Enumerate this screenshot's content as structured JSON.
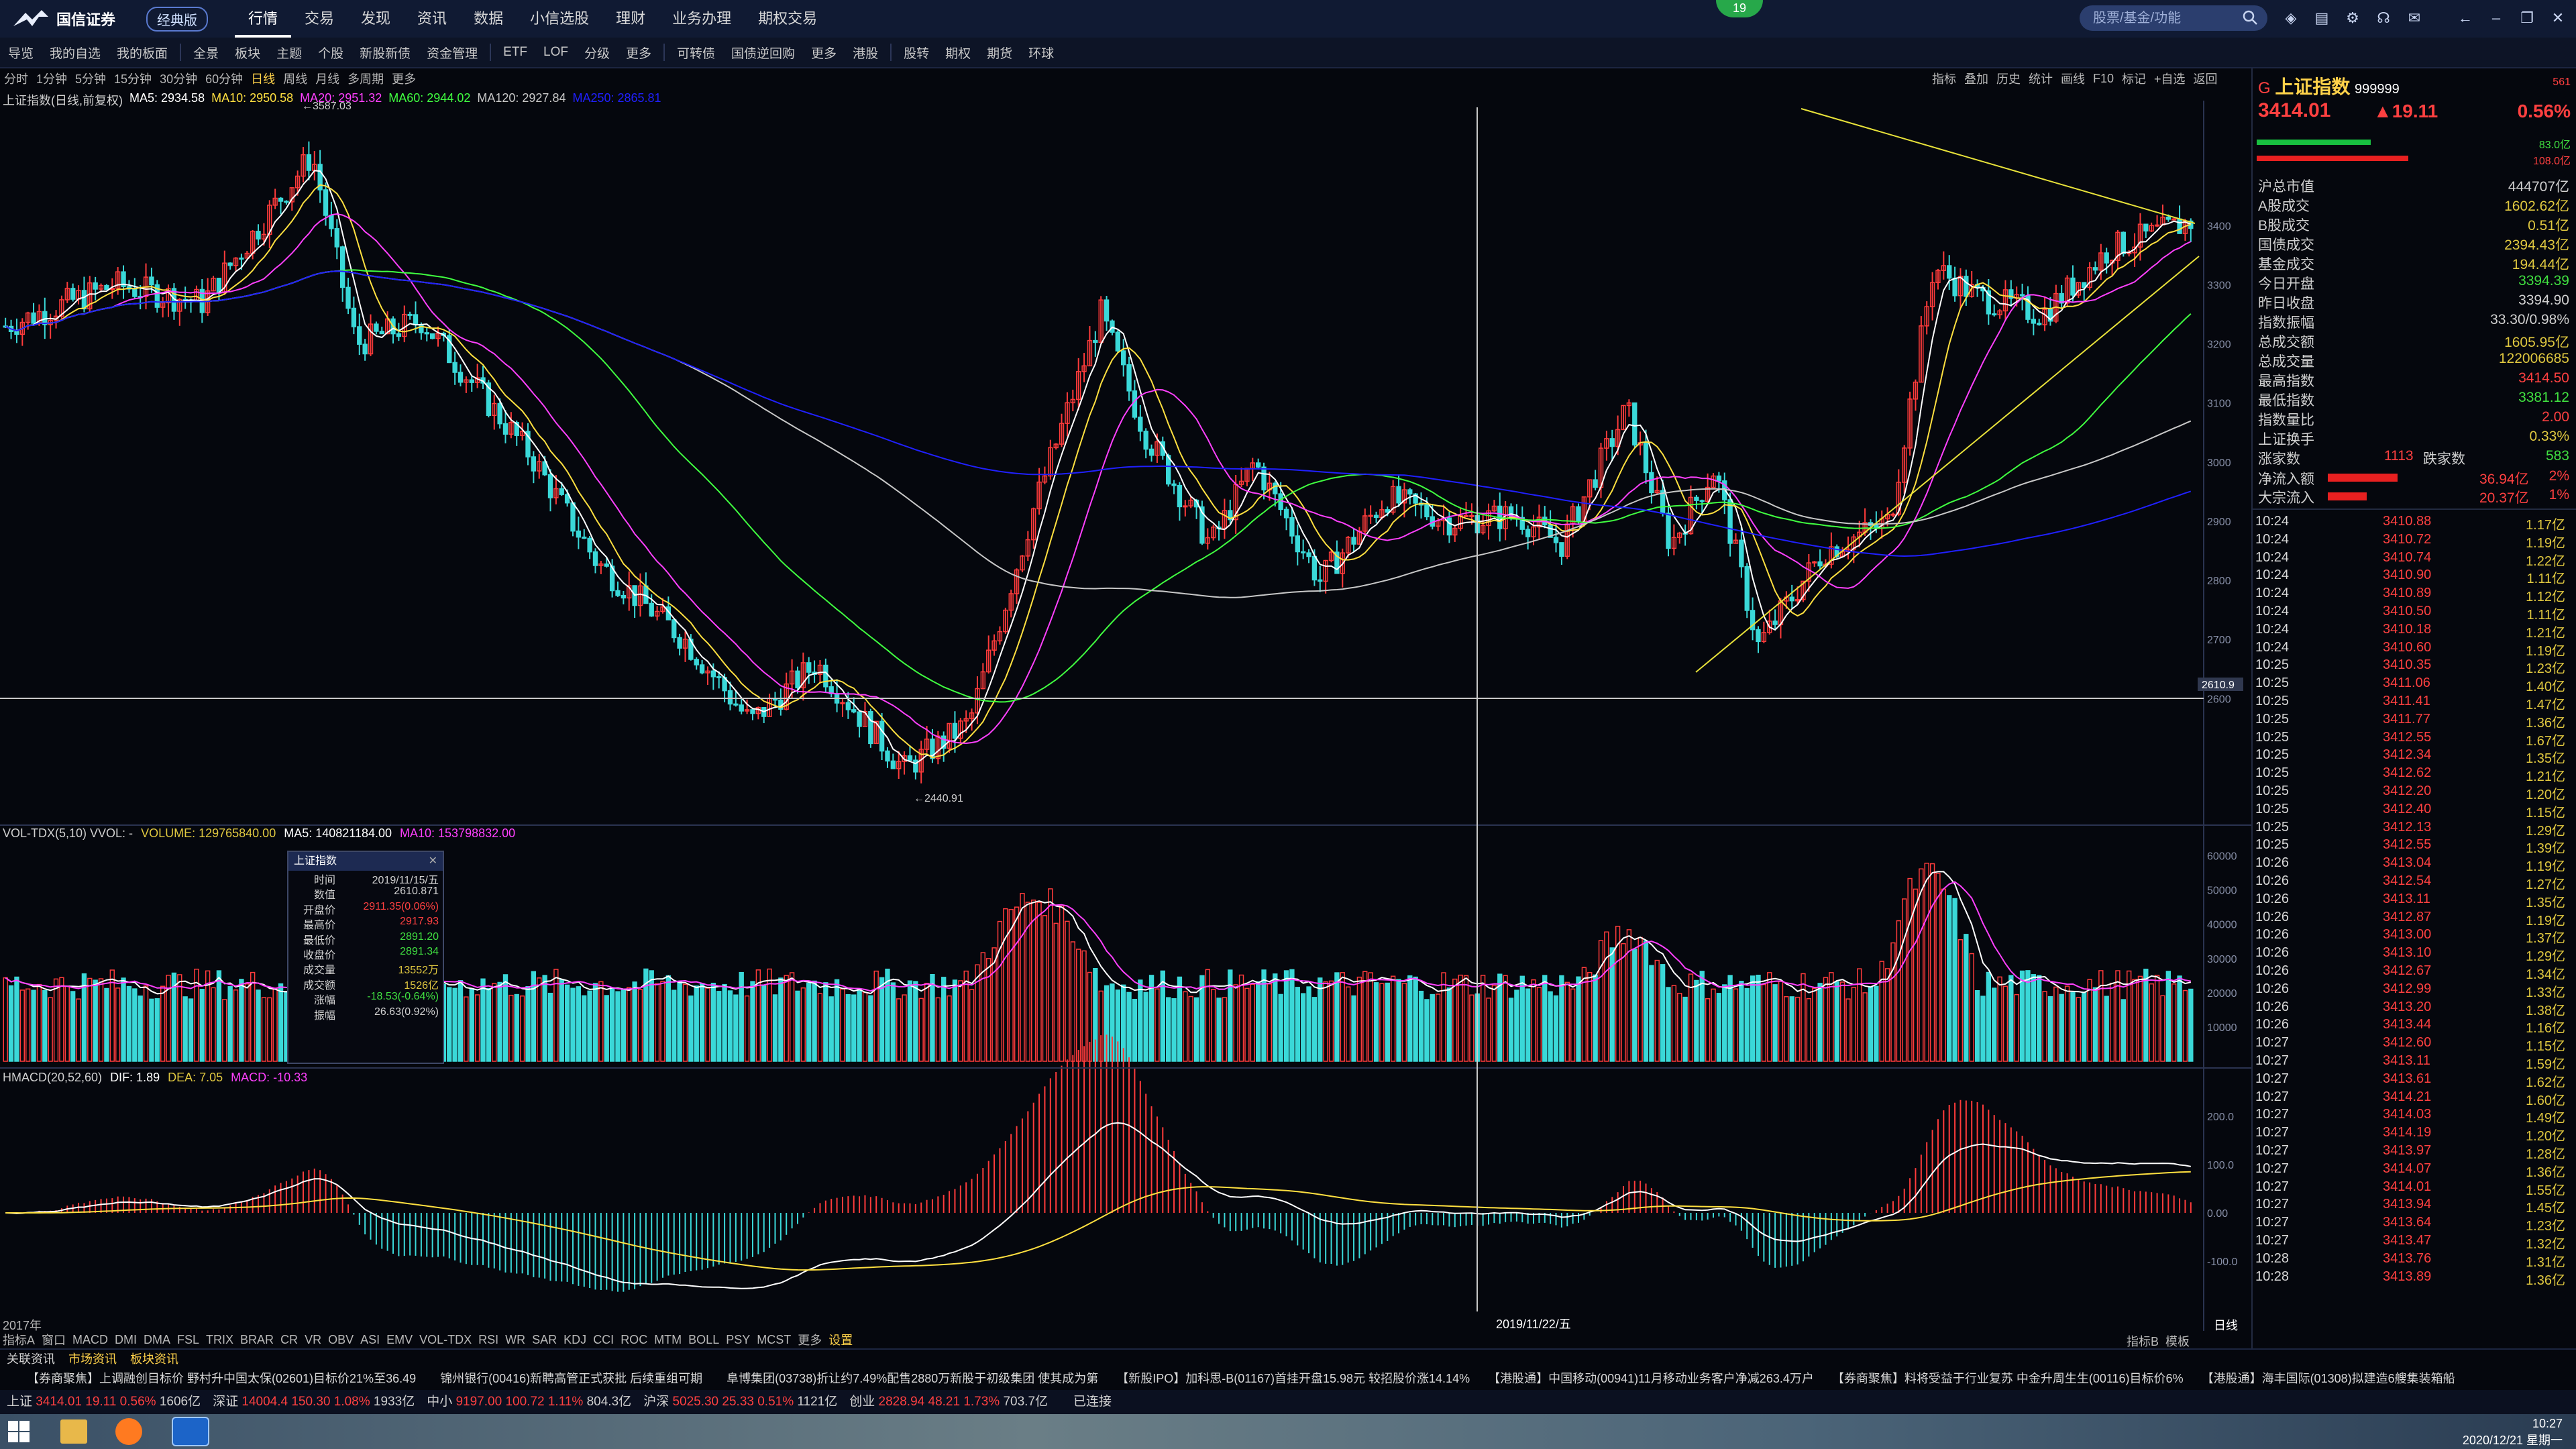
{
  "app": {
    "logo_text": "国信证券",
    "edition": "经典版",
    "notification_count": "19",
    "search_placeholder": "股票/基金/功能"
  },
  "main_nav": [
    "行情",
    "交易",
    "发现",
    "资讯",
    "数据",
    "小信选股",
    "理财",
    "业务办理",
    "期权交易"
  ],
  "toolbar": [
    "导览",
    "我的自选",
    "我的板面",
    "全景",
    "板块",
    "主题",
    "个股",
    "新股新债",
    "资金管理",
    "ETF",
    "LOF",
    "分级",
    "更多",
    "可转债",
    "国债逆回购",
    "更多",
    "港股",
    "股转",
    "期权",
    "期货",
    "环球"
  ],
  "periods": {
    "items": [
      "分时",
      "1分钟",
      "5分钟",
      "15分钟",
      "30分钟",
      "60分钟",
      "日线",
      "周线",
      "月线",
      "多周期",
      "更多"
    ],
    "selected": "日线"
  },
  "right_tools": [
    "指标",
    "叠加",
    "历史",
    "统计",
    "画线",
    "F10",
    "标记",
    "+自选",
    "返回"
  ],
  "main_chart": {
    "legend_prefix": "上证指数(日线,前复权)",
    "ma": [
      {
        "label": "MA5: 2934.58",
        "color": "#ffffff"
      },
      {
        "label": "MA10: 2950.58",
        "color": "#ffe040"
      },
      {
        "label": "MA20: 2951.32",
        "color": "#ff40ff"
      },
      {
        "label": "MA60: 2944.02",
        "color": "#40ff40"
      },
      {
        "label": "MA120: 2927.84",
        "color": "#c8c8c8"
      },
      {
        "label": "MA250: 2865.81",
        "color": "#2020ff"
      }
    ],
    "high_label": "3587.03",
    "low_label": "2440.91",
    "crosshair_value": "2610.9",
    "y_ticks": [
      "3400",
      "3300",
      "3200",
      "3100",
      "3000",
      "2900",
      "2800",
      "2700",
      "2600"
    ]
  },
  "volume_chart": {
    "title": "VOL-TDX(5,10) VVOL: -",
    "volume": "VOLUME: 129765840.00",
    "ma5": "MA5: 140821184.00",
    "ma10": "MA10: 153798832.00",
    "y_ticks": [
      "60000",
      "50000",
      "40000",
      "30000",
      "20000",
      "10000"
    ],
    "unit": "X万"
  },
  "macd_chart": {
    "title": "HMACD(20,52,60)",
    "dif": "DIF: 1.89",
    "dea": "DEA: 7.05",
    "macd": "MACD: -10.33",
    "y_ticks": [
      "200.0",
      "100.0",
      "0.00",
      "-100.0"
    ],
    "date_label": "2019/11/22/五",
    "x_left": "2017年",
    "period_tag": "日线"
  },
  "popup": {
    "title": "上证指数",
    "rows": [
      {
        "k": "时间",
        "v": "2019/11/15/五",
        "c": "#d0d0d0"
      },
      {
        "k": "数值",
        "v": "2610.871",
        "c": "#d0d0d0"
      },
      {
        "k": "开盘价",
        "v": "2911.35(0.06%)",
        "c": "#ff4040"
      },
      {
        "k": "最高价",
        "v": "2917.93",
        "c": "#ff4040"
      },
      {
        "k": "最低价",
        "v": "2891.20",
        "c": "#40e040"
      },
      {
        "k": "收盘价",
        "v": "2891.34",
        "c": "#40e040"
      },
      {
        "k": "成交量",
        "v": "13552万",
        "c": "#e0c840"
      },
      {
        "k": "成交额",
        "v": "1526亿",
        "c": "#e0c840"
      },
      {
        "k": "涨幅",
        "v": "-18.53(-0.64%)",
        "c": "#40e040"
      },
      {
        "k": "振幅",
        "v": "26.63(0.92%)",
        "c": "#d0d0d0"
      }
    ]
  },
  "quote": {
    "code_prefix": "G",
    "name": "上证指数",
    "code": "999999",
    "tag": "561",
    "price": "3414.01",
    "change": "▲19.11",
    "pct": "0.56%",
    "bar1": "83.0亿",
    "bar2": "108.0亿",
    "rows": [
      {
        "k": "沪总市值",
        "v": "444707亿",
        "c": "#d0d0d0"
      },
      {
        "k": "A股成交",
        "v": "1602.62亿",
        "c": "#e0c840"
      },
      {
        "k": "B股成交",
        "v": "0.51亿",
        "c": "#e0c840"
      },
      {
        "k": "国债成交",
        "v": "2394.43亿",
        "c": "#e0c840"
      },
      {
        "k": "基金成交",
        "v": "194.44亿",
        "c": "#e0c840"
      },
      {
        "k": "今日开盘",
        "v": "3394.39",
        "c": "#40e040"
      },
      {
        "k": "昨日收盘",
        "v": "3394.90",
        "c": "#d0d0d0"
      },
      {
        "k": "指数振幅",
        "v": "33.30/0.98%",
        "c": "#d0d0d0"
      },
      {
        "k": "总成交额",
        "v": "1605.95亿",
        "c": "#e0c840"
      },
      {
        "k": "总成交量",
        "v": "122006685",
        "c": "#e0c840"
      },
      {
        "k": "最高指数",
        "v": "3414.50",
        "c": "#ff4040"
      },
      {
        "k": "最低指数",
        "v": "3381.12",
        "c": "#40e040"
      },
      {
        "k": "指数量比",
        "v": "2.00",
        "c": "#ff4040"
      },
      {
        "k": "上证换手",
        "v": "0.33%",
        "c": "#e0c840"
      }
    ],
    "up_label": "涨家数",
    "up_count": "1113",
    "down_label": "跌家数",
    "down_count": "583",
    "net_inflow_label": "净流入额",
    "net_inflow_value": "36.94亿",
    "net_inflow_pct": "2%",
    "big_inflow_label": "大宗流入",
    "big_inflow_value": "20.37亿",
    "big_inflow_pct": "1%"
  },
  "ticks": [
    [
      "10:24",
      "3410.88",
      "1.17亿"
    ],
    [
      "10:24",
      "3410.72",
      "1.19亿"
    ],
    [
      "10:24",
      "3410.74",
      "1.22亿"
    ],
    [
      "10:24",
      "3410.90",
      "1.11亿"
    ],
    [
      "10:24",
      "3410.89",
      "1.12亿"
    ],
    [
      "10:24",
      "3410.50",
      "1.11亿"
    ],
    [
      "10:24",
      "3410.18",
      "1.21亿"
    ],
    [
      "10:24",
      "3410.60",
      "1.19亿"
    ],
    [
      "10:25",
      "3410.35",
      "1.23亿"
    ],
    [
      "10:25",
      "3411.06",
      "1.40亿"
    ],
    [
      "10:25",
      "3411.41",
      "1.47亿"
    ],
    [
      "10:25",
      "3411.77",
      "1.36亿"
    ],
    [
      "10:25",
      "3412.55",
      "1.67亿"
    ],
    [
      "10:25",
      "3412.34",
      "1.35亿"
    ],
    [
      "10:25",
      "3412.62",
      "1.21亿"
    ],
    [
      "10:25",
      "3412.20",
      "1.20亿"
    ],
    [
      "10:25",
      "3412.40",
      "1.15亿"
    ],
    [
      "10:25",
      "3412.13",
      "1.29亿"
    ],
    [
      "10:25",
      "3412.55",
      "1.39亿"
    ],
    [
      "10:26",
      "3413.04",
      "1.19亿"
    ],
    [
      "10:26",
      "3412.54",
      "1.27亿"
    ],
    [
      "10:26",
      "3413.11",
      "1.35亿"
    ],
    [
      "10:26",
      "3412.87",
      "1.19亿"
    ],
    [
      "10:26",
      "3413.00",
      "1.37亿"
    ],
    [
      "10:26",
      "3413.10",
      "1.29亿"
    ],
    [
      "10:26",
      "3412.67",
      "1.34亿"
    ],
    [
      "10:26",
      "3412.99",
      "1.33亿"
    ],
    [
      "10:26",
      "3413.20",
      "1.38亿"
    ],
    [
      "10:26",
      "3413.44",
      "1.16亿"
    ],
    [
      "10:27",
      "3412.60",
      "1.15亿"
    ],
    [
      "10:27",
      "3413.11",
      "1.59亿"
    ],
    [
      "10:27",
      "3413.61",
      "1.62亿"
    ],
    [
      "10:27",
      "3414.21",
      "1.60亿"
    ],
    [
      "10:27",
      "3414.03",
      "1.49亿"
    ],
    [
      "10:27",
      "3414.19",
      "1.20亿"
    ],
    [
      "10:27",
      "3413.97",
      "1.28亿"
    ],
    [
      "10:27",
      "3414.07",
      "1.36亿"
    ],
    [
      "10:27",
      "3414.01",
      "1.55亿"
    ],
    [
      "10:27",
      "3413.94",
      "1.45亿"
    ],
    [
      "10:27",
      "3413.64",
      "1.23亿"
    ],
    [
      "10:27",
      "3413.47",
      "1.32亿"
    ],
    [
      "10:28",
      "3413.76",
      "1.31亿"
    ],
    [
      "10:28",
      "3413.89",
      "1.36亿"
    ]
  ],
  "indicator_bar": [
    "指标A",
    "窗口",
    "MACD",
    "DMI",
    "DMA",
    "FSL",
    "TRIX",
    "BRAR",
    "CR",
    "VR",
    "OBV",
    "ASI",
    "EMV",
    "VOL-TDX",
    "RSI",
    "WR",
    "SAR",
    "KDJ",
    "CCI",
    "ROC",
    "MTM",
    "BOLL",
    "PSY",
    "MCST",
    "更多",
    "设置"
  ],
  "indicator_bar_right": [
    "指标B",
    "模板"
  ],
  "news_tabs": [
    "关联资讯",
    "市场资讯",
    "板块资讯"
  ],
  "ticker": "【券商聚焦】上调融创目标价 野村升中国太保(02601)目标价21%至36.49　　锦州银行(00416)新聘高管正式获批 后续重组可期　　阜博集团(03738)折让约7.49%配售2880万新股于初级集团 使其成为第　　【新股IPO】加科思-B(01167)首挂开盘15.98元 较招股价涨14.14%　　【港股通】中国移动(00941)11月移动业务客户净减263.4万户　　【券商聚焦】料将受益于行业复苏 中金升周生生(00116)目标价6%　　【港股通】海丰国际(01308)拟建造6艘集装箱船",
  "status": {
    "sh": {
      "name": "上证",
      "price": "3414.01",
      "chg": "19.11",
      "pct": "0.56%",
      "amt": "1606亿"
    },
    "sz": {
      "name": "深证",
      "price": "14004.4",
      "chg": "150.30",
      "pct": "1.08%",
      "amt": "1933亿"
    },
    "zx": {
      "name": "中小",
      "price": "9197.00",
      "chg": "100.72",
      "pct": "1.11%",
      "amt": "804.3亿"
    },
    "hs": {
      "name": "沪深",
      "price": "5025.30",
      "chg": "25.33",
      "pct": "0.51%",
      "amt": "1121亿"
    },
    "cy": {
      "name": "创业",
      "price": "2828.94",
      "chg": "48.21",
      "pct": "1.73%",
      "amt": "703.7亿"
    },
    "conn": "已连接"
  },
  "clock": {
    "time": "10:27",
    "date": "2020/12/21 星期一"
  }
}
